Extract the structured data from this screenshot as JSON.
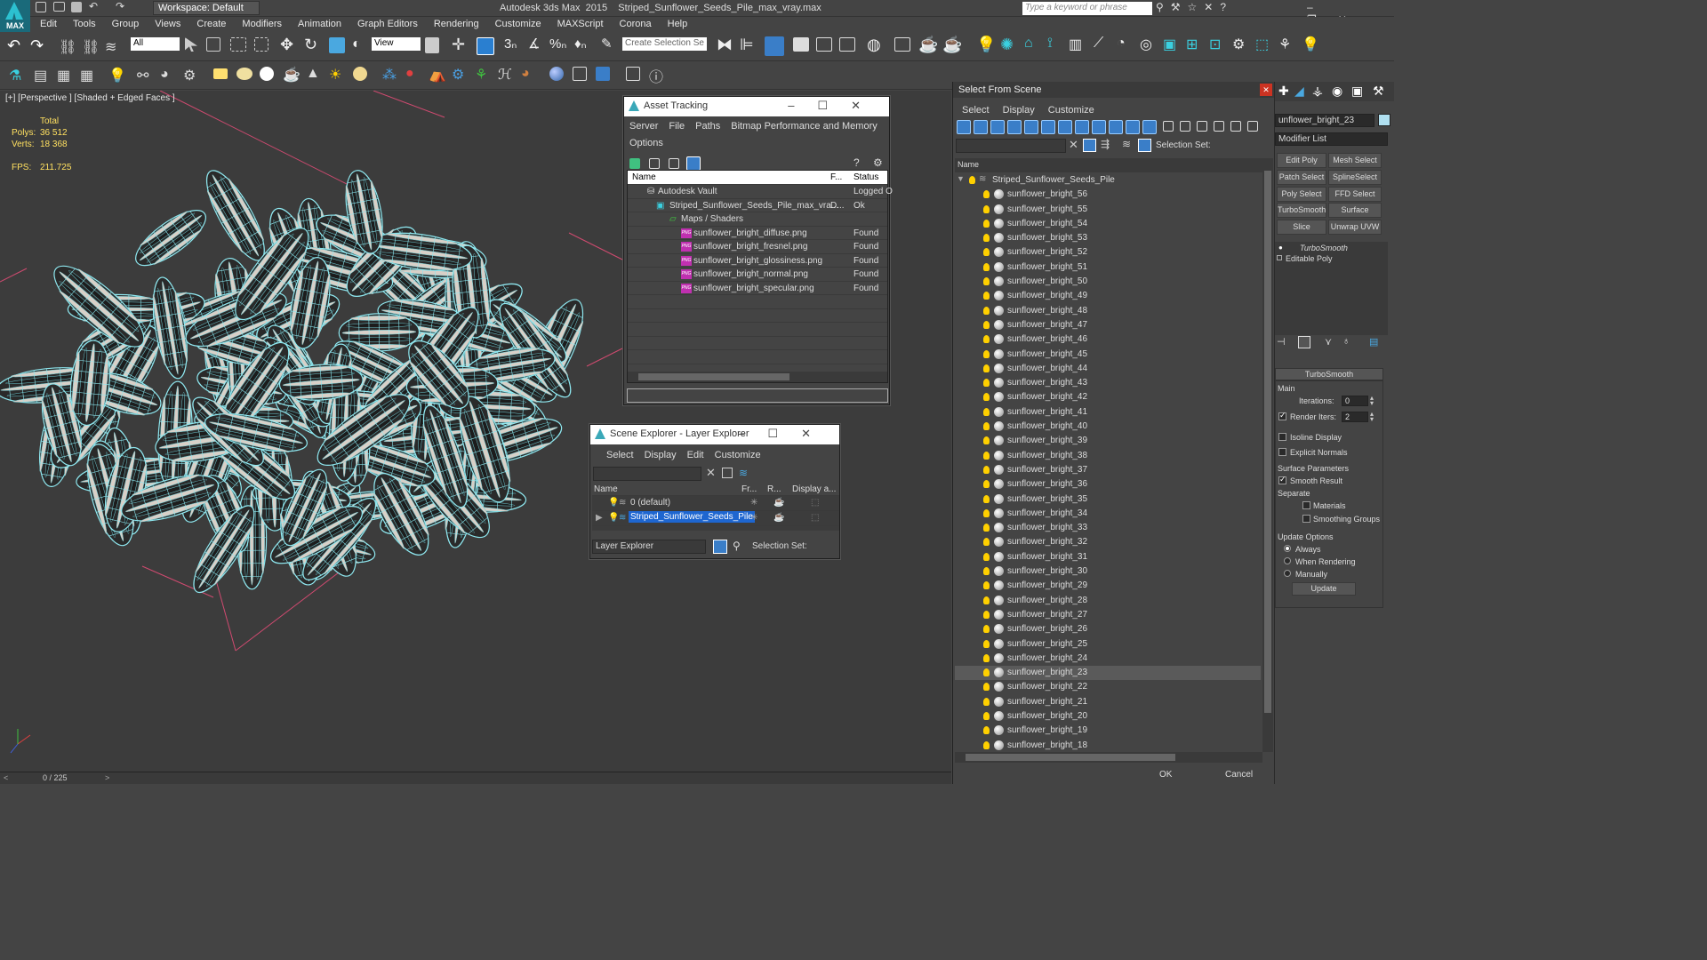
{
  "app": {
    "title": "Autodesk 3ds Max  2015    Striped_Sunflower_Seeds_Pile_max_vray.max",
    "workspace": "Workspace: Default",
    "search_placeholder": "Type a keyword or phrase",
    "logo": "MAX"
  },
  "menu": [
    "Edit",
    "Tools",
    "Group",
    "Views",
    "Create",
    "Modifiers",
    "Animation",
    "Graph Editors",
    "Rendering",
    "Customize",
    "MAXScript",
    "Corona",
    "Help"
  ],
  "toolbar": {
    "filter": "All",
    "view": "View",
    "selection_set": "Create Selection Se"
  },
  "viewport": {
    "label": "[+] [Perspective ] [Shaded + Edged Faces ]",
    "stats": {
      "total_label": "Total",
      "polys_label": "Polys:",
      "polys": "36 512",
      "verts_label": "Verts:",
      "verts": "18 368",
      "fps_label": "FPS:",
      "fps": "211.725"
    }
  },
  "status": {
    "frame": "0 / 225"
  },
  "asset_tracking": {
    "title": "Asset Tracking",
    "menu": [
      "Server",
      "File",
      "Paths",
      "Bitmap Performance and Memory",
      "Options"
    ],
    "columns": [
      "Name",
      "F...",
      "Status"
    ],
    "rows": [
      {
        "name": "Autodesk Vault",
        "f": "",
        "status": "Logged O"
      },
      {
        "name": "Striped_Sunflower_Seeds_Pile_max_vra...",
        "f": "D...",
        "status": "Ok"
      },
      {
        "name": "Maps / Shaders",
        "f": "",
        "status": ""
      },
      {
        "name": "sunflower_bright_diffuse.png",
        "f": "",
        "status": "Found"
      },
      {
        "name": "sunflower_bright_fresnel.png",
        "f": "",
        "status": "Found"
      },
      {
        "name": "sunflower_bright_glossiness.png",
        "f": "",
        "status": "Found"
      },
      {
        "name": "sunflower_bright_normal.png",
        "f": "",
        "status": "Found"
      },
      {
        "name": "sunflower_bright_specular.png",
        "f": "",
        "status": "Found"
      }
    ]
  },
  "layer_explorer": {
    "title": "Scene Explorer - Layer Explorer",
    "menu": [
      "Select",
      "Display",
      "Edit",
      "Customize"
    ],
    "columns": [
      "Name",
      "Fr...",
      "R...",
      "Display a..."
    ],
    "rows": [
      "0 (default)",
      "Striped_Sunflower_Seeds_Pile"
    ],
    "footer": "Layer Explorer",
    "selection_set": "Selection Set:"
  },
  "select_from_scene": {
    "title": "Select From Scene",
    "menu": [
      "Select",
      "Display",
      "Customize"
    ],
    "selection_set": "Selection Set:",
    "column": "Name",
    "root": "Striped_Sunflower_Seeds_Pile",
    "items": [
      "sunflower_bright_56",
      "sunflower_bright_55",
      "sunflower_bright_54",
      "sunflower_bright_53",
      "sunflower_bright_52",
      "sunflower_bright_51",
      "sunflower_bright_50",
      "sunflower_bright_49",
      "sunflower_bright_48",
      "sunflower_bright_47",
      "sunflower_bright_46",
      "sunflower_bright_45",
      "sunflower_bright_44",
      "sunflower_bright_43",
      "sunflower_bright_42",
      "sunflower_bright_41",
      "sunflower_bright_40",
      "sunflower_bright_39",
      "sunflower_bright_38",
      "sunflower_bright_37",
      "sunflower_bright_36",
      "sunflower_bright_35",
      "sunflower_bright_34",
      "sunflower_bright_33",
      "sunflower_bright_32",
      "sunflower_bright_31",
      "sunflower_bright_30",
      "sunflower_bright_29",
      "sunflower_bright_28",
      "sunflower_bright_27",
      "sunflower_bright_26",
      "sunflower_bright_25",
      "sunflower_bright_24",
      "sunflower_bright_23",
      "sunflower_bright_22",
      "sunflower_bright_21",
      "sunflower_bright_20",
      "sunflower_bright_19",
      "sunflower_bright_18"
    ],
    "selected": "sunflower_bright_23",
    "ok": "OK",
    "cancel": "Cancel"
  },
  "command_panel": {
    "object_name": "unflower_bright_23",
    "modifier_list": "Modifier List",
    "buttons": [
      "Edit Poly",
      "Mesh Select",
      "Patch Select",
      "SplineSelect",
      "Poly Select",
      "FFD Select",
      "TurboSmooth",
      "Surface Select",
      "Slice",
      "Unwrap UVW"
    ],
    "stack": [
      "TurboSmooth",
      "Editable Poly"
    ],
    "rollout": {
      "title": "TurboSmooth",
      "main": "Main",
      "iterations_label": "Iterations:",
      "iterations": "0",
      "render_iters_label": "Render Iters:",
      "render_iters": "2",
      "isoline": "Isoline Display",
      "explicit": "Explicit Normals",
      "surface_params": "Surface Parameters",
      "smooth_result": "Smooth Result",
      "separate": "Separate",
      "materials": "Materials",
      "smoothing_groups": "Smoothing Groups",
      "update_options": "Update Options",
      "always": "Always",
      "when_rendering": "When Rendering",
      "manually": "Manually",
      "update": "Update"
    }
  }
}
